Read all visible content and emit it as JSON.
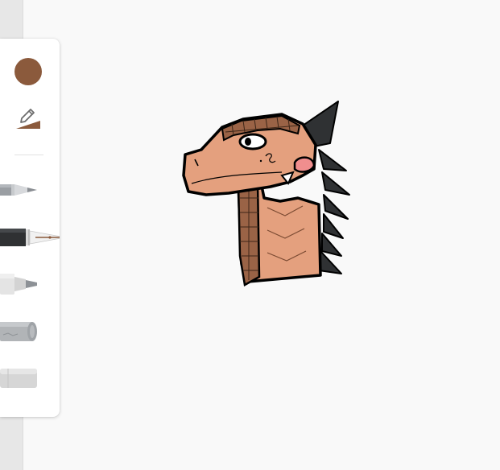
{
  "app": {
    "accent_color": "#8b5a3c"
  },
  "toolbar": {
    "color_swatch": {
      "color": "#8b5a3c",
      "icon": "color-swatch-icon"
    },
    "stroke_size": {
      "icon": "pencil-size-icon"
    },
    "tools": [
      {
        "icon": "pencil-icon"
      },
      {
        "icon": "fountain-pen-icon",
        "selected": true
      },
      {
        "icon": "marker-icon"
      },
      {
        "icon": "pencil-stub-icon"
      },
      {
        "icon": "eraser-icon"
      }
    ]
  },
  "canvas": {
    "background": "#f9f9f9",
    "artwork": "dragon-head-drawing"
  }
}
